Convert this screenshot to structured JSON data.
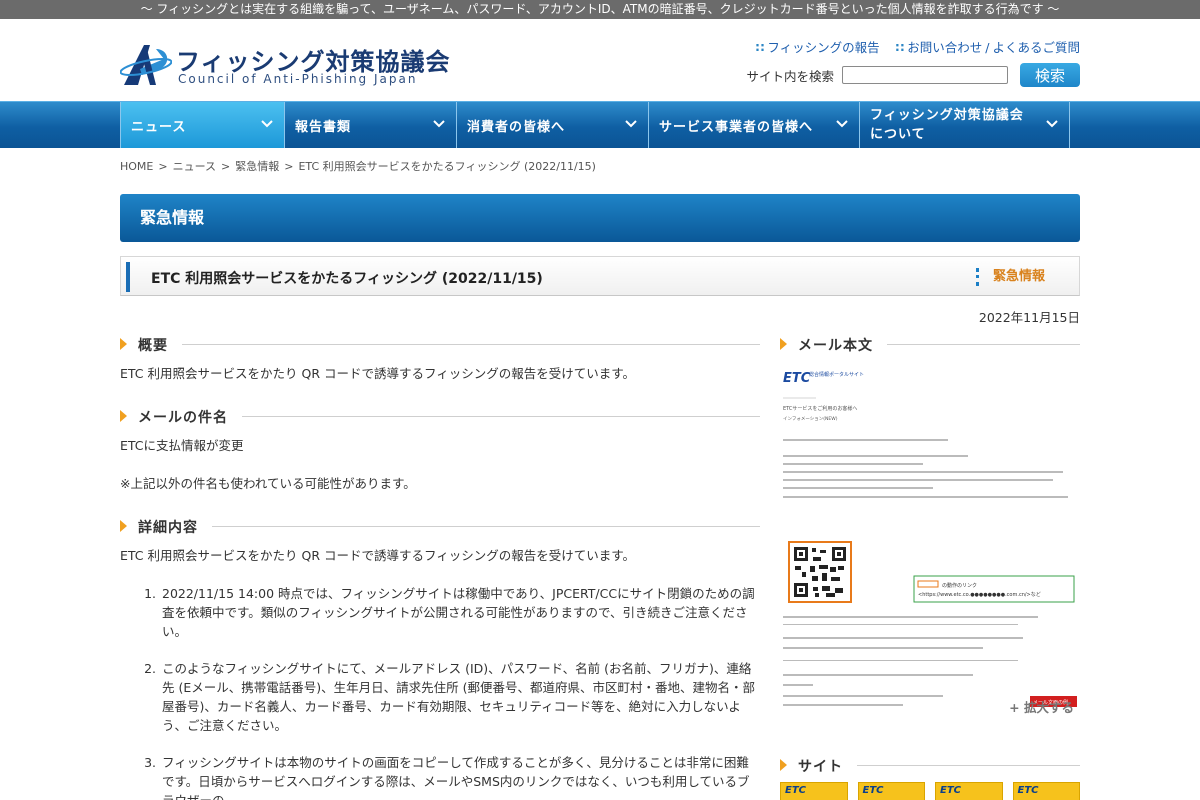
{
  "topbar": {
    "text": "〜 フィッシングとは実在する組織を騙って、ユーザネーム、パスワード、アカウントID、ATMの暗証番号、クレジットカード番号といった個人情報を詐取する行為です 〜"
  },
  "header": {
    "logo_title": "フィッシング対策協議会",
    "logo_subtitle": "Council of Anti-Phishing Japan",
    "links": [
      "フィッシングの報告",
      "お問い合わせ",
      "よくあるご質問"
    ],
    "link_bullet": "∷",
    "link_separator": "/",
    "search_label": "サイト内を検索",
    "search_value": "",
    "search_button": "検索"
  },
  "nav": {
    "items": [
      {
        "label": "ニュース"
      },
      {
        "label": "報告書類"
      },
      {
        "label": "消費者の皆様へ"
      },
      {
        "label": "サービス事業者の皆様へ"
      },
      {
        "label_line1": "フィッシング対策協議会",
        "label_line2": "について"
      }
    ]
  },
  "breadcrumb": {
    "items": [
      "HOME",
      "ニュース",
      "緊急情報",
      "ETC 利用照会サービスをかたるフィッシング (2022/11/15)"
    ],
    "separator": ">"
  },
  "banner": {
    "title": "緊急情報"
  },
  "article": {
    "title": "ETC 利用照会サービスをかたるフィッシング (2022/11/15)",
    "tag": "緊急情報",
    "date": "2022年11月15日",
    "sections": {
      "overview": {
        "heading": "概要",
        "text": "ETC 利用照会サービスをかたり QR コードで誘導するフィッシングの報告を受けています。"
      },
      "subject": {
        "heading": "メールの件名",
        "text": "ETCに支払情報が変更",
        "note": "※上記以外の件名も使われている可能性があります。"
      },
      "details": {
        "heading": "詳細内容",
        "text": "ETC 利用照会サービスをかたり QR コードで誘導するフィッシングの報告を受けています。",
        "items": [
          "2022/11/15 14:00 時点では、フィッシングサイトは稼働中であり、JPCERT/CCにサイト閉鎖のための調査を依頼中です。類似のフィッシングサイトが公開される可能性がありますので、引き続きご注意ください。",
          "このようなフィッシングサイトにて、メールアドレス (ID)、パスワード、名前 (お名前、フリガナ)、連絡先 (Eメール、携帯電話番号)、生年月日、請求先住所 (郵便番号、都道府県、市区町村・番地、建物名・部屋番号)、カード名義人、カード番号、カード有効期限、セキュリティコード等を、絶対に入力しないよう、ご注意ください。",
          "フィッシングサイトは本物のサイトの画面をコピーして作成することが多く、見分けることは非常に困難です。日頃からサービスへログインする際は、メールやSMS内のリンクではなく、いつも利用しているブラウザーの"
        ]
      }
    }
  },
  "sidebar": {
    "mail_heading": "メール本文",
    "mail_image": {
      "logo": "ETC",
      "header_text": "総合情報ポータルサイト",
      "greeting": "ETCサービスをご利用のお客様へ",
      "subheader": "インフォメーション(NEW)",
      "link_box_label": "の動作のリンク",
      "link_box_url": "<https://www.etc.co.●●●●●●●●.com.cn/>など",
      "corner_badge": "メール文面の例"
    },
    "expand": "拡大する",
    "site_heading": "サイト",
    "site_thumbs": [
      "ETC",
      "ETC",
      "ETC",
      "ETC"
    ]
  },
  "colors": {
    "nav_blue": "#0f5fa3",
    "accent_orange": "#f0a020",
    "tag_orange": "#d9821d",
    "link_blue": "#1f5fae"
  }
}
